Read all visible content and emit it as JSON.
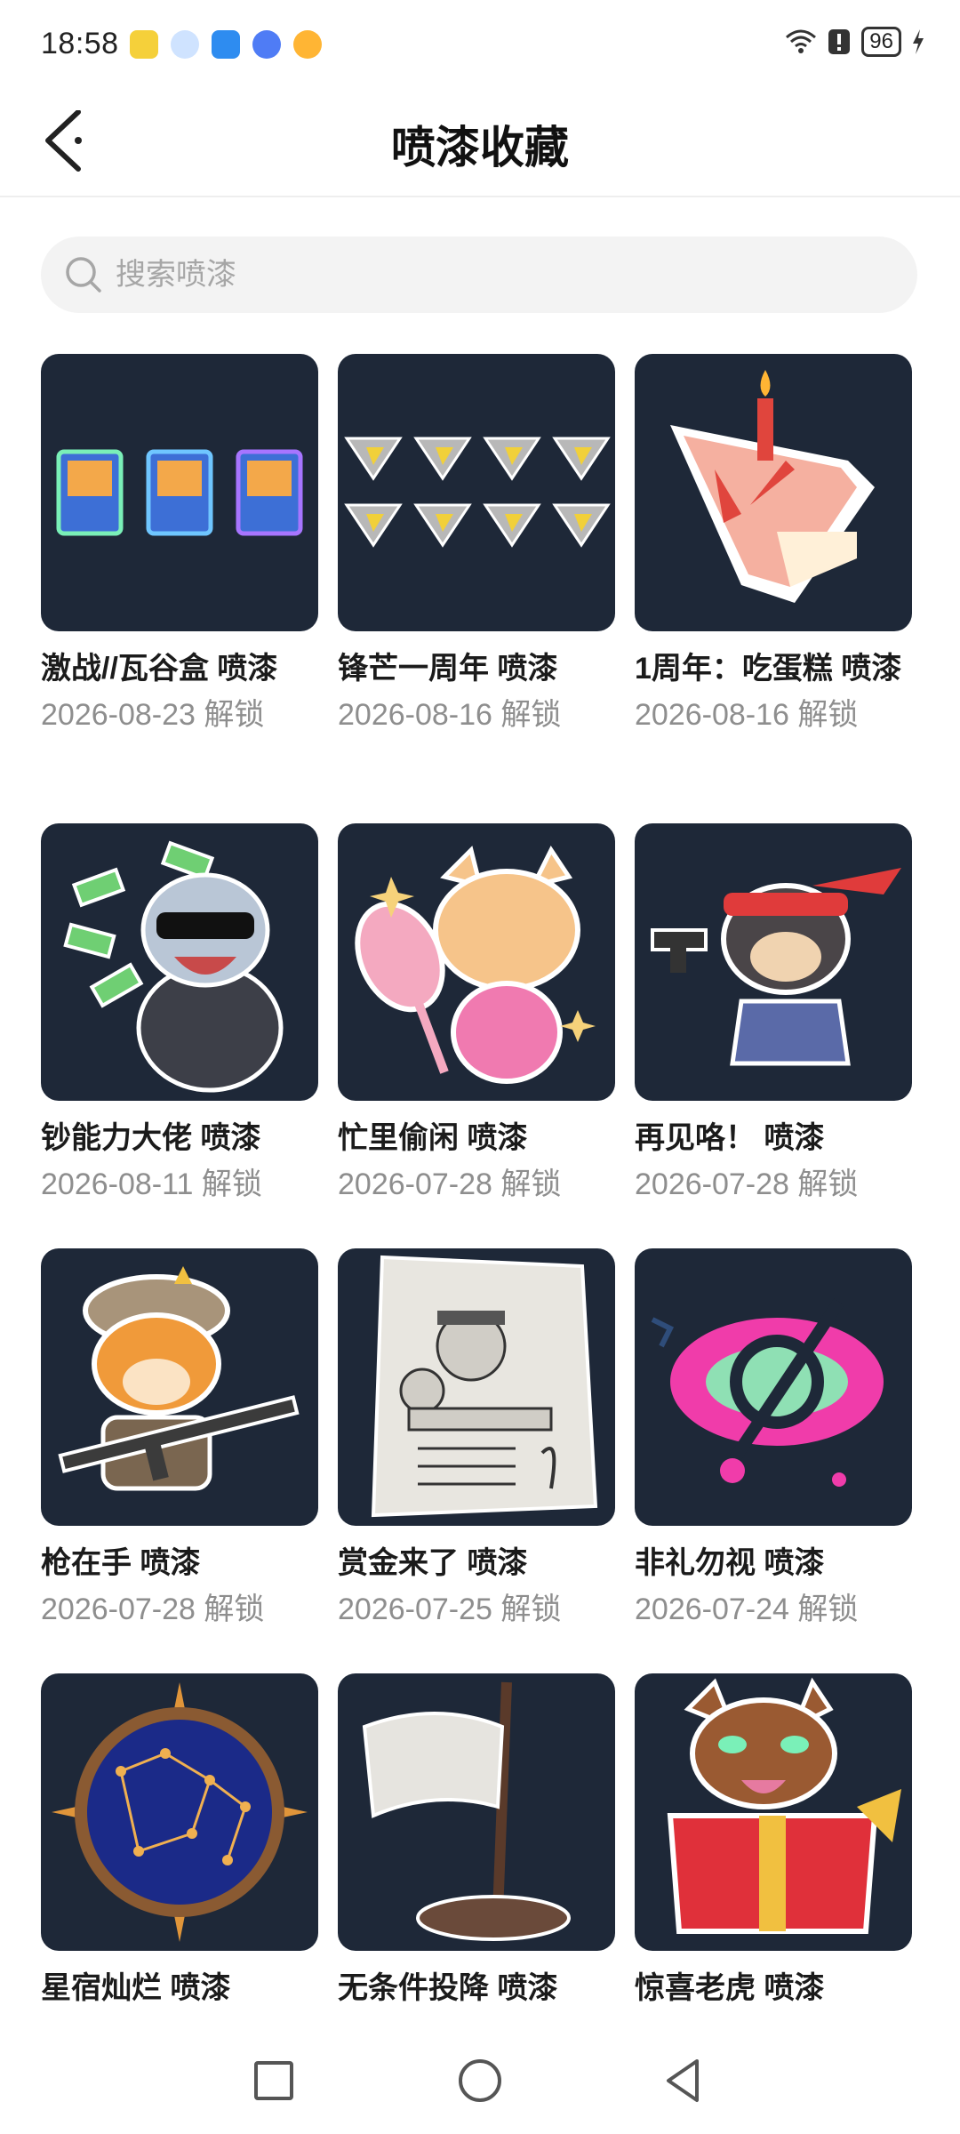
{
  "status": {
    "time": "18:58",
    "battery": "96"
  },
  "header": {
    "title": "喷漆收藏"
  },
  "search": {
    "placeholder": "搜索喷漆"
  },
  "items": [
    {
      "name": "激战//瓦谷盒 喷漆",
      "date": "2026-08-23 解锁",
      "icon": "valorant-box-icon"
    },
    {
      "name": "锋芒一周年 喷漆",
      "date": "2026-08-16 解锁",
      "icon": "anniversary-badges-icon"
    },
    {
      "name": "1周年：吃蛋糕 喷漆",
      "date": "2026-08-16 解锁",
      "icon": "birthday-cake-icon"
    },
    {
      "name": "钞能力大佬 喷漆",
      "date": "2026-08-11 解锁",
      "icon": "money-sloth-icon"
    },
    {
      "name": "忙里偷闲 喷漆",
      "date": "2026-07-28 解锁",
      "icon": "fox-mirror-icon"
    },
    {
      "name": "再见咯！ 喷漆",
      "date": "2026-07-28 解锁",
      "icon": "dog-gun-icon"
    },
    {
      "name": "枪在手 喷漆",
      "date": "2026-07-28 解锁",
      "icon": "fox-rifle-icon"
    },
    {
      "name": "赏金来了 喷漆",
      "date": "2026-07-25 解锁",
      "icon": "wanted-poster-icon"
    },
    {
      "name": "非礼勿视 喷漆",
      "date": "2026-07-24 解锁",
      "icon": "crossed-eye-icon"
    },
    {
      "name": "星宿灿烂 喷漆",
      "date": "",
      "icon": "constellation-icon"
    },
    {
      "name": "无条件投降 喷漆",
      "date": "",
      "icon": "white-flag-icon"
    },
    {
      "name": "惊喜老虎 喷漆",
      "date": "",
      "icon": "tiger-gift-icon"
    }
  ]
}
